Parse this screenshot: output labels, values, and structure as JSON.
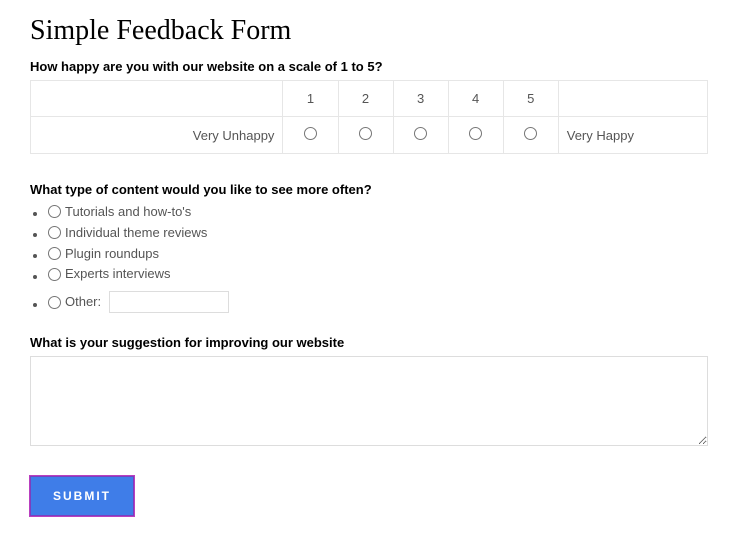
{
  "title": "Simple Feedback Form",
  "q1": {
    "label": "How happy are you with our website on a scale of 1 to 5?",
    "scale": {
      "n1": "1",
      "n2": "2",
      "n3": "3",
      "n4": "4",
      "n5": "5"
    },
    "left_anchor": "Very Unhappy",
    "right_anchor": "Very Happy"
  },
  "q2": {
    "label": "What type of content would you like to see more often?",
    "options": {
      "o1": "Tutorials and how-to's",
      "o2": "Individual theme reviews",
      "o3": "Plugin roundups",
      "o4": "Experts interviews",
      "other_label": "Other:"
    }
  },
  "q3": {
    "label": "What is your suggestion for improving our website"
  },
  "submit_label": "SUBMIT"
}
